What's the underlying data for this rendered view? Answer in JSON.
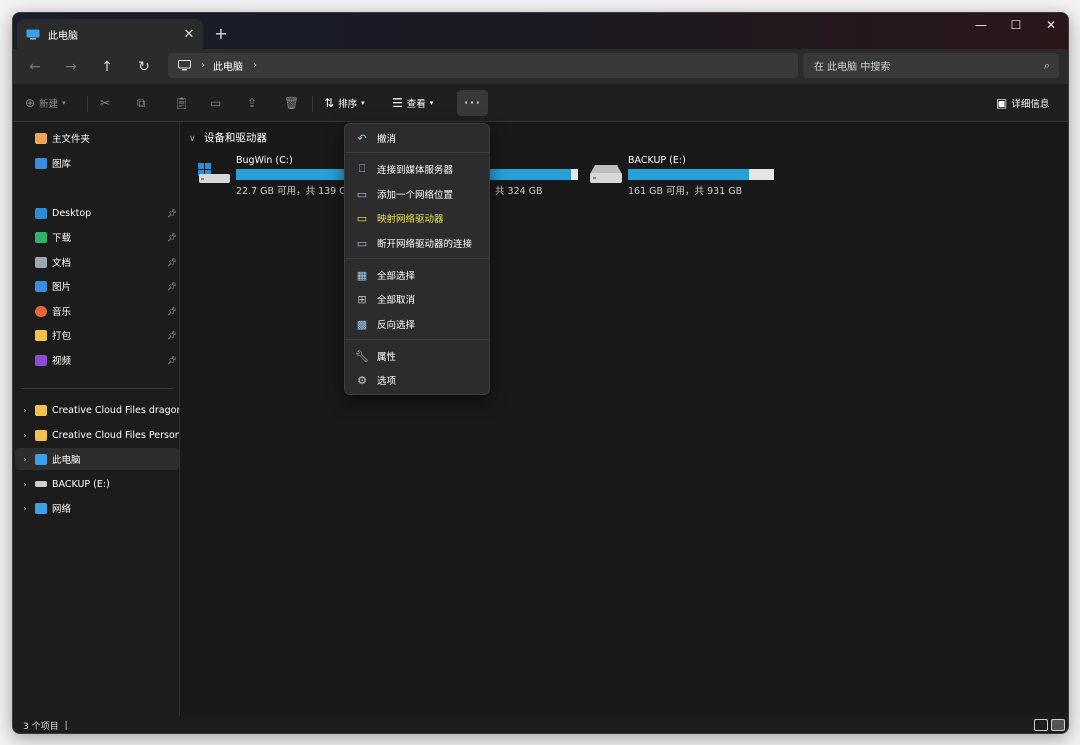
{
  "window": {
    "tab_title": "此电脑",
    "tab_close": "✕",
    "new_tab": "+",
    "controls": {
      "minimize": "—",
      "maximize": "☐",
      "close": "✕"
    }
  },
  "navigation": {
    "back": "←",
    "forward": "→",
    "up": "↑",
    "refresh": "↻",
    "breadcrumb": [
      "此电脑"
    ],
    "search_placeholder": "在 此电脑 中搜索"
  },
  "toolbar": {
    "new_label": "新建",
    "sort_label": "排序",
    "view_label": "查看",
    "more_label": "···",
    "details_label": "详细信息"
  },
  "sidebar": {
    "quick": [
      {
        "label": "主文件夹",
        "icon": "home-icon"
      },
      {
        "label": "图库",
        "icon": "gallery-icon"
      }
    ],
    "pinned": [
      {
        "label": "Desktop",
        "icon": "desktop-icon",
        "color": "#2e8bd6"
      },
      {
        "label": "下载",
        "icon": "download-icon",
        "color": "#2fb36b"
      },
      {
        "label": "文档",
        "icon": "document-icon",
        "color": "#9ba7b5"
      },
      {
        "label": "图片",
        "icon": "pictures-icon",
        "color": "#3a8ee0"
      },
      {
        "label": "音乐",
        "icon": "music-icon",
        "color": "#e8663a"
      },
      {
        "label": "打包",
        "icon": "folder-icon",
        "color": "#f2c14e"
      },
      {
        "label": "视频",
        "icon": "video-icon",
        "color": "#8a4bd6"
      }
    ],
    "tree": [
      {
        "label": "Creative Cloud Files  dragon",
        "icon": "folder-icon",
        "color": "#f2c14e"
      },
      {
        "label": "Creative Cloud Files Personal",
        "icon": "folder-icon",
        "color": "#f2c14e"
      },
      {
        "label": "此电脑",
        "icon": "computer-icon",
        "color": "#3aa0e8",
        "selected": true
      },
      {
        "label": "BACKUP (E:)",
        "icon": "drive-icon",
        "color": "#cfcfcf"
      },
      {
        "label": "网络",
        "icon": "network-icon",
        "color": "#3aa0e8"
      }
    ]
  },
  "main": {
    "group_title": "设备和驱动器",
    "drives": [
      {
        "name": "BugWin (C:)",
        "info": "22.7 GB 可用，共 139 GB",
        "used_fraction": 0.84,
        "icon": "windows-drive-icon"
      },
      {
        "name": "",
        "info": "共 324 GB",
        "used_fraction": 0.95,
        "icon": "drive-icon"
      },
      {
        "name": "BACKUP (E:)",
        "info": "161 GB 可用，共 931 GB",
        "used_fraction": 0.83,
        "icon": "drive-icon"
      }
    ]
  },
  "more_menu": {
    "items": [
      {
        "label": "撤消",
        "icon": "undo-icon"
      },
      {
        "label": "连接到媒体服务器",
        "icon": "media-server-icon"
      },
      {
        "label": "添加一个网络位置",
        "icon": "network-location-icon"
      },
      {
        "label": "映射网络驱动器",
        "icon": "map-drive-icon",
        "highlighted": true
      },
      {
        "label": "断开网络驱动器的连接",
        "icon": "disconnect-drive-icon"
      },
      {
        "label": "全部选择",
        "icon": "select-all-icon"
      },
      {
        "label": "全部取消",
        "icon": "select-none-icon"
      },
      {
        "label": "反向选择",
        "icon": "invert-selection-icon"
      },
      {
        "label": "属性",
        "icon": "properties-icon"
      },
      {
        "label": "选项",
        "icon": "options-icon"
      }
    ]
  },
  "status": {
    "item_count": "3 个项目",
    "cursor": "|"
  },
  "colors": {
    "accent": "#27a0d8",
    "highlight": "#e9e44f"
  }
}
